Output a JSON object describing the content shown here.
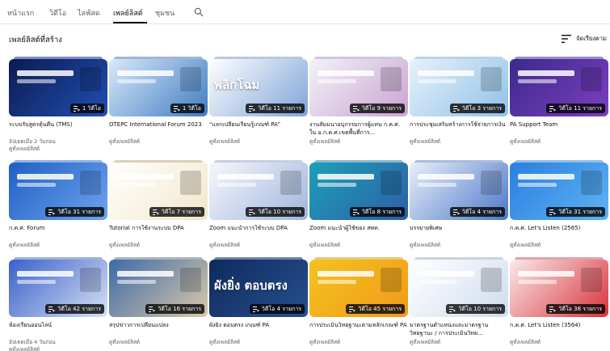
{
  "tabs": [
    {
      "label": "หน้าแรก"
    },
    {
      "label": "วิดีโอ"
    },
    {
      "label": "ไลฟ์สด"
    },
    {
      "label": "เพลย์ลิสต์"
    },
    {
      "label": "ชุมชน"
    }
  ],
  "active_tab": "เพลย์ลิสต์",
  "section": {
    "title": "เพลย์ลิสต์ที่สร้าง",
    "sort_label": "จัดเรียงตาม"
  },
  "playlists": [
    {
      "title": "ระบบรับสูตรตุ้นคืน (TMS)",
      "meta": [
        "อัปเดตเมื่อ 2 วันก่อน",
        "ดูทั้งเพลย์ลิสต์"
      ],
      "count": "1 วิดีโอ",
      "colors": [
        "#0d1b4f",
        "#1f4fb5"
      ],
      "stack_color": "#7d8fc2"
    },
    {
      "title": "OTEPC International Forum 2023",
      "meta": [
        "ดูทั้งเพลย์ลิสต์"
      ],
      "count": "1 วิดีโอ",
      "colors": [
        "#d9e8f7",
        "#3f7cc4"
      ],
      "stack_color": "#9fb7d6"
    },
    {
      "title": "\"แลกเปลี่ยนเรียนรู้เกณฑ์ PA\"",
      "meta": [
        "ดูทั้งเพลย์ลิสต์"
      ],
      "count": "วิดีโอ 11 รายการ",
      "thumb_text": "พลิกโฉม",
      "colors": [
        "#ffffff",
        "#7ea4d8"
      ],
      "stack_color": "#b8c8de"
    },
    {
      "title": "งานสัมมนาอนุกรรมการผู้แทน ก.ค.ศ. ใน อ.ก.ค.ศ.เขตพื้นที่การ...",
      "meta": [
        "ดูทั้งเพลย์ลิสต์"
      ],
      "count": "วิดีโอ 9 รายการ",
      "colors": [
        "#f2f2f7",
        "#c9a3d3"
      ],
      "stack_color": "#cfc6e0"
    },
    {
      "title": "การประชุมเสริมสร้างการใช้จ่ายการเงิน",
      "meta": [
        "ดูทั้งเพลย์ลิสต์"
      ],
      "count": "วิดีโอ 3 รายการ",
      "colors": [
        "#e8f1fa",
        "#8fc1e8"
      ],
      "stack_color": "#b8d3ea"
    },
    {
      "title": "PA Support Team",
      "meta": [
        "ดูทั้งเพลย์ลิสต์"
      ],
      "count": "วิดีโอ 11 รายการ",
      "colors": [
        "#3a2a8c",
        "#7d3fbf"
      ],
      "stack_color": "#9a8cc9"
    },
    {
      "title": "ก.ค.ศ. Forum",
      "meta": [
        "ดูทั้งเพลย์ลิสต์"
      ],
      "count": "วิดีโอ 31 รายการ",
      "colors": [
        "#1f5fc4",
        "#6ea4ef"
      ],
      "stack_color": "#8fb2e6"
    },
    {
      "title": "Tutorial การใช้งานระบบ DPA",
      "meta": [
        "ดูทั้งเพลย์ลิสต์"
      ],
      "count": "วิดีโอ 7 รายการ",
      "colors": [
        "#ffffff",
        "#f2e7c9"
      ],
      "stack_color": "#d9d0b8"
    },
    {
      "title": "Zoom แนะนำการใช้ระบบ DPA",
      "meta": [
        "ดูทั้งเพลย์ลิสต์"
      ],
      "count": "วิดีโอ 10 รายการ",
      "colors": [
        "#f7f7fb",
        "#9eb6dd"
      ],
      "stack_color": "#c6cfe0"
    },
    {
      "title": "Zoom แนะนำผู้ใช้ของ สพท.",
      "meta": [
        "ดูทั้งเพลย์ลิสต์"
      ],
      "count": "วิดีโอ 8 รายการ",
      "colors": [
        "#1d9fb7",
        "#2d5ea8"
      ],
      "stack_color": "#87b9cc"
    },
    {
      "title": "บรรยายพิเศษ",
      "meta": [
        "ดูทั้งเพลย์ลิสต์"
      ],
      "count": "วิดีโอ 4 รายการ",
      "colors": [
        "#e9eef8",
        "#4a78c9"
      ],
      "stack_color": "#a9bcdf"
    },
    {
      "title": "ก.ค.ศ. Let's Listen (2565)",
      "meta": [
        "ดูทั้งเพลย์ลิสต์"
      ],
      "count": "วิดีโอ 31 รายการ",
      "colors": [
        "#2a7fe0",
        "#5fb3f2"
      ],
      "stack_color": "#8fbfe8"
    },
    {
      "title": "ห้องเรียนออนไลน์",
      "meta": [
        "อัปเดตเมื่อ 4 วันก่อน",
        "ดูทั้งเพลย์ลิสต์"
      ],
      "count": "วิดีโอ 42 รายการ",
      "colors": [
        "#3a5fc9",
        "#d7e2f6"
      ],
      "stack_color": "#9cb1df"
    },
    {
      "title": "สรุปข่าวการเปลี่ยนแปลง",
      "meta": [
        "ดูทั้งเพลย์ลิสต์"
      ],
      "count": "วิดีโอ 16 รายการ",
      "colors": [
        "#3e6aa8",
        "#d8c9a8"
      ],
      "stack_color": "#a8b3c2"
    },
    {
      "title": "ผังยิ่ง ตอบตรง เกณฑ์ PA",
      "meta": [
        "ดูทั้งเพลย์ลิสต์"
      ],
      "count": "วิดีโอ 4 รายการ",
      "thumb_text": "ผังยิ่ง ตอบตรง",
      "colors": [
        "#0e2a5c",
        "#27508f"
      ],
      "stack_color": "#6d83a8"
    },
    {
      "title": "การประเมินวิทยฐานะตามหลักเกณฑ์ PA",
      "meta": [
        "ดูทั้งเพลย์ลิสต์"
      ],
      "count": "วิดีโอ 45 รายการ",
      "colors": [
        "#f4c21f",
        "#f09a1a"
      ],
      "stack_color": "#e6c97a"
    },
    {
      "title": "มาตรฐานตำแหน่งและมาตรฐานวิทยฐานะ / การประเมินวิทย...",
      "meta": [
        "ดูทั้งเพลย์ลิสต์"
      ],
      "count": "วิดีโอ 10 รายการ",
      "colors": [
        "#ffffff",
        "#cfdcef"
      ],
      "stack_color": "#c9d2df"
    },
    {
      "title": "ก.ค.ศ. Let's Listen (3564)",
      "meta": [
        "ดูทั้งเพลย์ลิสต์"
      ],
      "count": "วิดีโอ 38 รายการ",
      "colors": [
        "#fbe9ea",
        "#d6333c"
      ],
      "stack_color": "#e2a3a7"
    }
  ]
}
